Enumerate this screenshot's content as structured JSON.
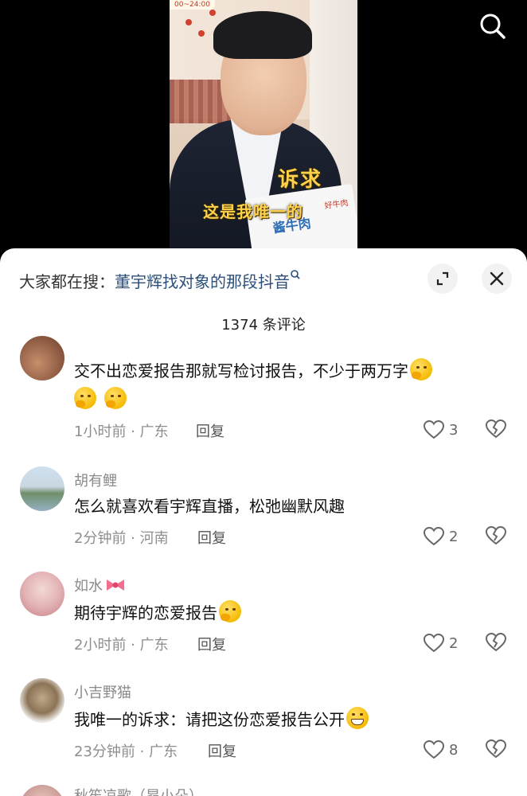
{
  "video": {
    "timer": "00~24:00",
    "caption_line1": "诉求",
    "caption_line2": "这是我唯一的",
    "package_brand": "酱牛肉",
    "package_small": "好牛肉",
    "package_small2": "酱牛"
  },
  "search_bar": {
    "prefix": "大家都在搜：",
    "keyword": "董宇辉找对象的那段抖音"
  },
  "comments_header": {
    "count_label": "1374 条评论"
  },
  "comments": [
    {
      "name": "",
      "text": "交不出恋爱报告那就写检讨报告，不少于两万字",
      "meta": "1小时前 · 广东",
      "reply_label": "回复",
      "likes": "3"
    },
    {
      "name": "胡有鲤",
      "text": "怎么就喜欢看宇辉直播，松弛幽默风趣",
      "meta": "2分钟前 · 河南",
      "reply_label": "回复",
      "likes": "2"
    },
    {
      "name": "如水",
      "text": "期待宇辉的恋爱报告",
      "meta": "2小时前 · 广东",
      "reply_label": "回复",
      "likes": "2"
    },
    {
      "name": "小吉野猫",
      "text": "我唯一的诉求：请把这份恋爱报告公开",
      "meta": "23分钟前 · 广东",
      "reply_label": "回复",
      "likes": "8"
    },
    {
      "name": "秋笙凉歌（昂小朵）"
    }
  ],
  "icons": {
    "search": "search-icon",
    "expand": "expand-icon",
    "close": "close-icon",
    "like": "heart-icon",
    "dislike": "broken-heart-icon"
  },
  "colors": {
    "keyword": "#2c4f79",
    "caption": "#ffd24a",
    "sheet_bg": "#ffffff"
  }
}
